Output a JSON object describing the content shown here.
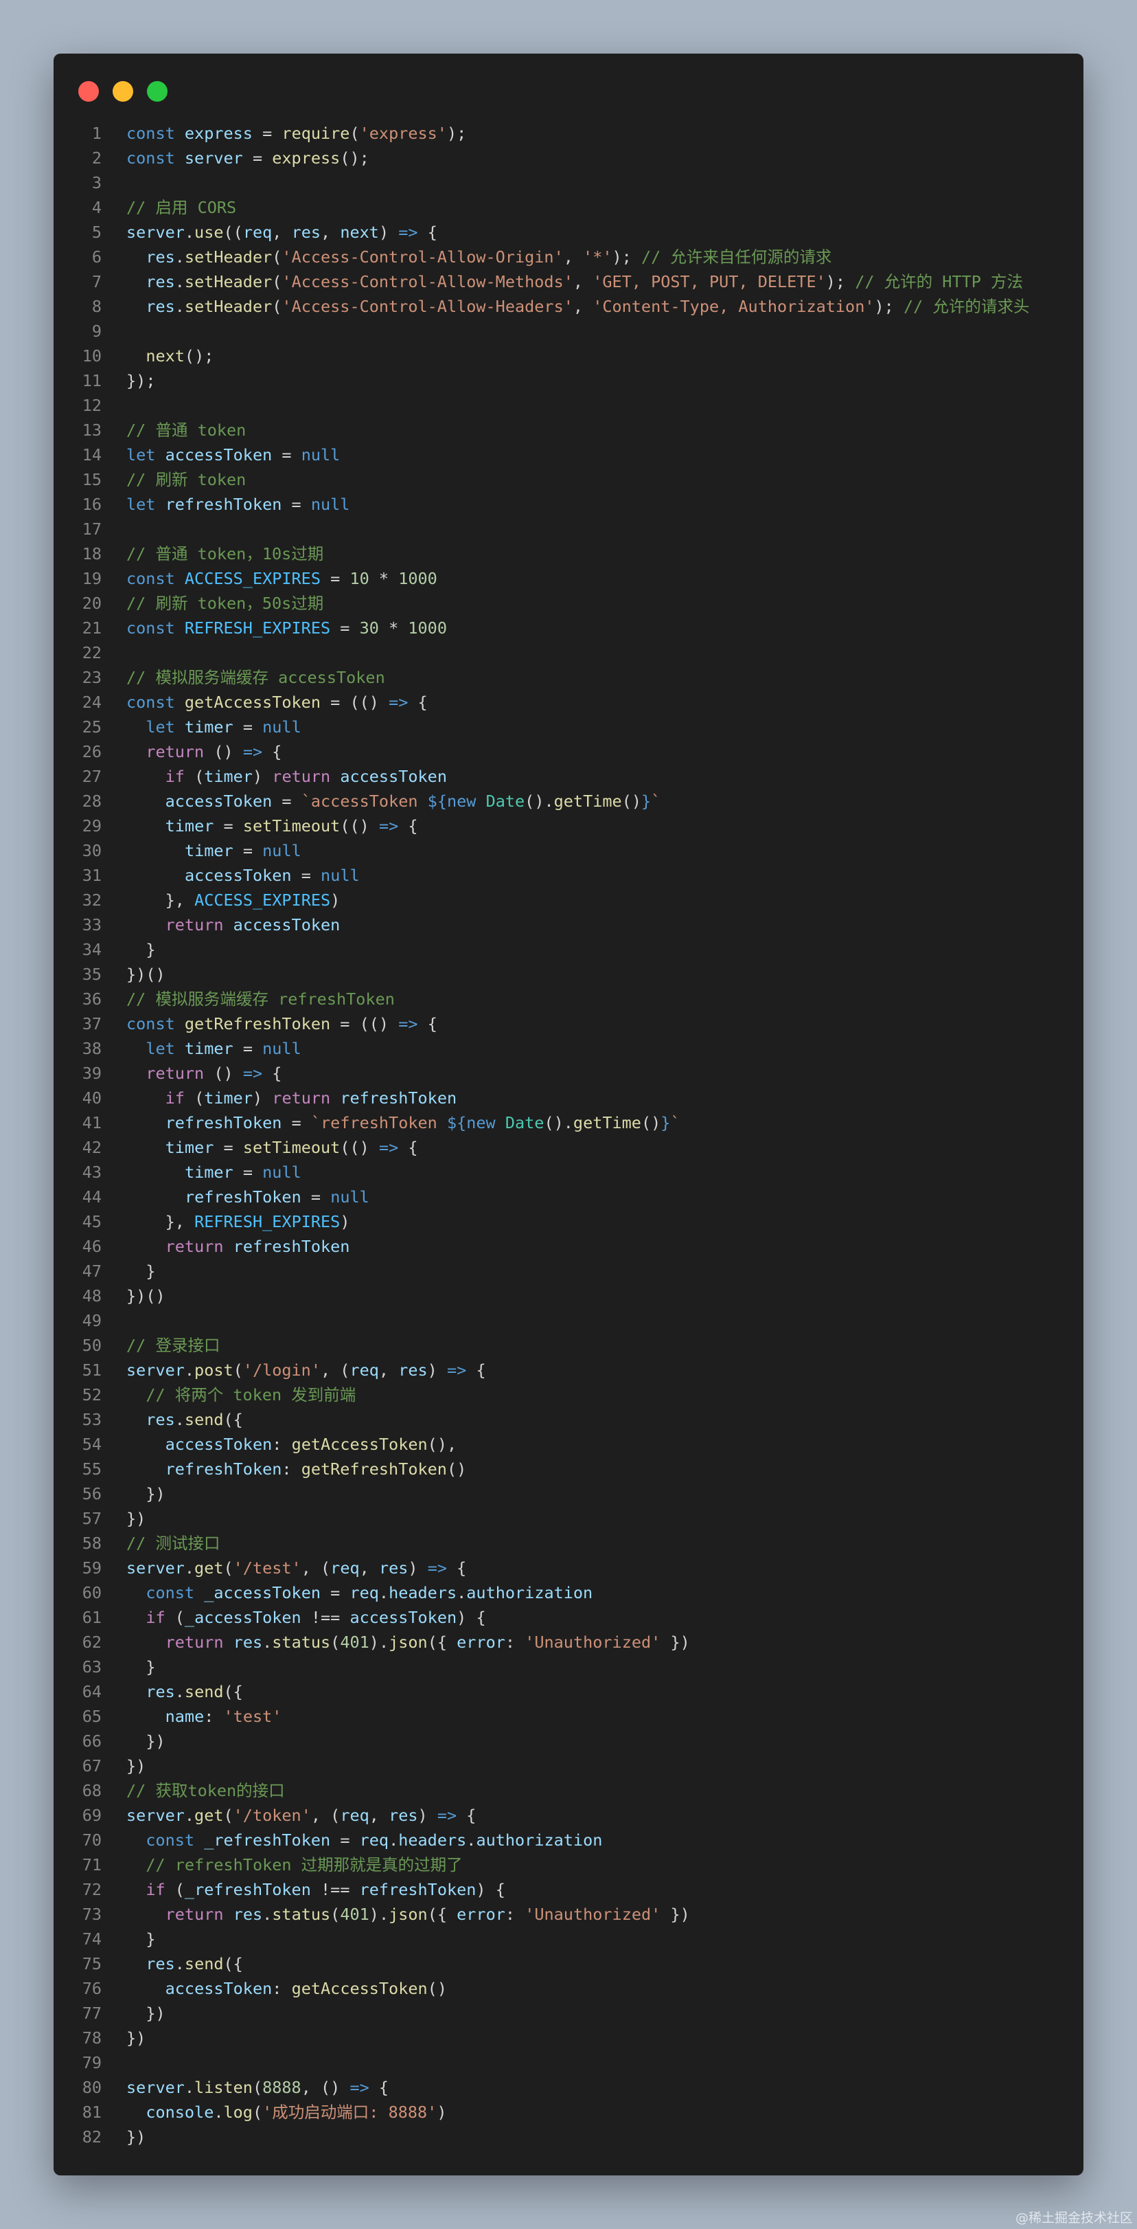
{
  "window": {
    "controls": [
      "close",
      "minimize",
      "maximize"
    ],
    "colors": {
      "close": "#ff5f57",
      "minimize": "#febc2e",
      "maximize": "#28c840"
    }
  },
  "watermark": "@稀土掘金技术社区",
  "code_lines": [
    {
      "n": "1",
      "text": "const express = require('express');"
    },
    {
      "n": "2",
      "text": "const server = express();"
    },
    {
      "n": "3",
      "text": ""
    },
    {
      "n": "4",
      "text": "// 启用 CORS"
    },
    {
      "n": "5",
      "text": "server.use((req, res, next) => {"
    },
    {
      "n": "6",
      "text": "  res.setHeader('Access-Control-Allow-Origin', '*'); // 允许来自任何源的请求"
    },
    {
      "n": "7",
      "text": "  res.setHeader('Access-Control-Allow-Methods', 'GET, POST, PUT, DELETE'); // 允许的 HTTP 方法"
    },
    {
      "n": "8",
      "text": "  res.setHeader('Access-Control-Allow-Headers', 'Content-Type, Authorization'); // 允许的请求头"
    },
    {
      "n": "9",
      "text": ""
    },
    {
      "n": "10",
      "text": "  next();"
    },
    {
      "n": "11",
      "text": "});"
    },
    {
      "n": "12",
      "text": ""
    },
    {
      "n": "13",
      "text": "// 普通 token"
    },
    {
      "n": "14",
      "text": "let accessToken = null"
    },
    {
      "n": "15",
      "text": "// 刷新 token"
    },
    {
      "n": "16",
      "text": "let refreshToken = null"
    },
    {
      "n": "17",
      "text": ""
    },
    {
      "n": "18",
      "text": "// 普通 token，10s过期"
    },
    {
      "n": "19",
      "text": "const ACCESS_EXPIRES = 10 * 1000"
    },
    {
      "n": "20",
      "text": "// 刷新 token，50s过期"
    },
    {
      "n": "21",
      "text": "const REFRESH_EXPIRES = 30 * 1000"
    },
    {
      "n": "22",
      "text": ""
    },
    {
      "n": "23",
      "text": "// 模拟服务端缓存 accessToken"
    },
    {
      "n": "24",
      "text": "const getAccessToken = (() => {"
    },
    {
      "n": "25",
      "text": "  let timer = null"
    },
    {
      "n": "26",
      "text": "  return () => {"
    },
    {
      "n": "27",
      "text": "    if (timer) return accessToken"
    },
    {
      "n": "28",
      "text": "    accessToken = `accessToken ${new Date().getTime()}`"
    },
    {
      "n": "29",
      "text": "    timer = setTimeout(() => {"
    },
    {
      "n": "30",
      "text": "      timer = null"
    },
    {
      "n": "31",
      "text": "      accessToken = null"
    },
    {
      "n": "32",
      "text": "    }, ACCESS_EXPIRES)"
    },
    {
      "n": "33",
      "text": "    return accessToken"
    },
    {
      "n": "34",
      "text": "  }"
    },
    {
      "n": "35",
      "text": "})()"
    },
    {
      "n": "36",
      "text": "// 模拟服务端缓存 refreshToken"
    },
    {
      "n": "37",
      "text": "const getRefreshToken = (() => {"
    },
    {
      "n": "38",
      "text": "  let timer = null"
    },
    {
      "n": "39",
      "text": "  return () => {"
    },
    {
      "n": "40",
      "text": "    if (timer) return refreshToken"
    },
    {
      "n": "41",
      "text": "    refreshToken = `refreshToken ${new Date().getTime()}`"
    },
    {
      "n": "42",
      "text": "    timer = setTimeout(() => {"
    },
    {
      "n": "43",
      "text": "      timer = null"
    },
    {
      "n": "44",
      "text": "      refreshToken = null"
    },
    {
      "n": "45",
      "text": "    }, REFRESH_EXPIRES)"
    },
    {
      "n": "46",
      "text": "    return refreshToken"
    },
    {
      "n": "47",
      "text": "  }"
    },
    {
      "n": "48",
      "text": "})()"
    },
    {
      "n": "49",
      "text": ""
    },
    {
      "n": "50",
      "text": "// 登录接口"
    },
    {
      "n": "51",
      "text": "server.post('/login', (req, res) => {"
    },
    {
      "n": "52",
      "text": "  // 将两个 token 发到前端"
    },
    {
      "n": "53",
      "text": "  res.send({"
    },
    {
      "n": "54",
      "text": "    accessToken: getAccessToken(),"
    },
    {
      "n": "55",
      "text": "    refreshToken: getRefreshToken()"
    },
    {
      "n": "56",
      "text": "  })"
    },
    {
      "n": "57",
      "text": "})"
    },
    {
      "n": "58",
      "text": "// 测试接口"
    },
    {
      "n": "59",
      "text": "server.get('/test', (req, res) => {"
    },
    {
      "n": "60",
      "text": "  const _accessToken = req.headers.authorization"
    },
    {
      "n": "61",
      "text": "  if (_accessToken !== accessToken) {"
    },
    {
      "n": "62",
      "text": "    return res.status(401).json({ error: 'Unauthorized' })"
    },
    {
      "n": "63",
      "text": "  }"
    },
    {
      "n": "64",
      "text": "  res.send({"
    },
    {
      "n": "65",
      "text": "    name: 'test'"
    },
    {
      "n": "66",
      "text": "  })"
    },
    {
      "n": "67",
      "text": "})"
    },
    {
      "n": "68",
      "text": "// 获取token的接口"
    },
    {
      "n": "69",
      "text": "server.get('/token', (req, res) => {"
    },
    {
      "n": "70",
      "text": "  const _refreshToken = req.headers.authorization"
    },
    {
      "n": "71",
      "text": "  // refreshToken 过期那就是真的过期了"
    },
    {
      "n": "72",
      "text": "  if (_refreshToken !== refreshToken) {"
    },
    {
      "n": "73",
      "text": "    return res.status(401).json({ error: 'Unauthorized' })"
    },
    {
      "n": "74",
      "text": "  }"
    },
    {
      "n": "75",
      "text": "  res.send({"
    },
    {
      "n": "76",
      "text": "    accessToken: getAccessToken()"
    },
    {
      "n": "77",
      "text": "  })"
    },
    {
      "n": "78",
      "text": "})"
    },
    {
      "n": "79",
      "text": ""
    },
    {
      "n": "80",
      "text": "server.listen(8888, () => {"
    },
    {
      "n": "81",
      "text": "  console.log('成功启动端口: 8888')"
    },
    {
      "n": "82",
      "text": "})"
    }
  ]
}
